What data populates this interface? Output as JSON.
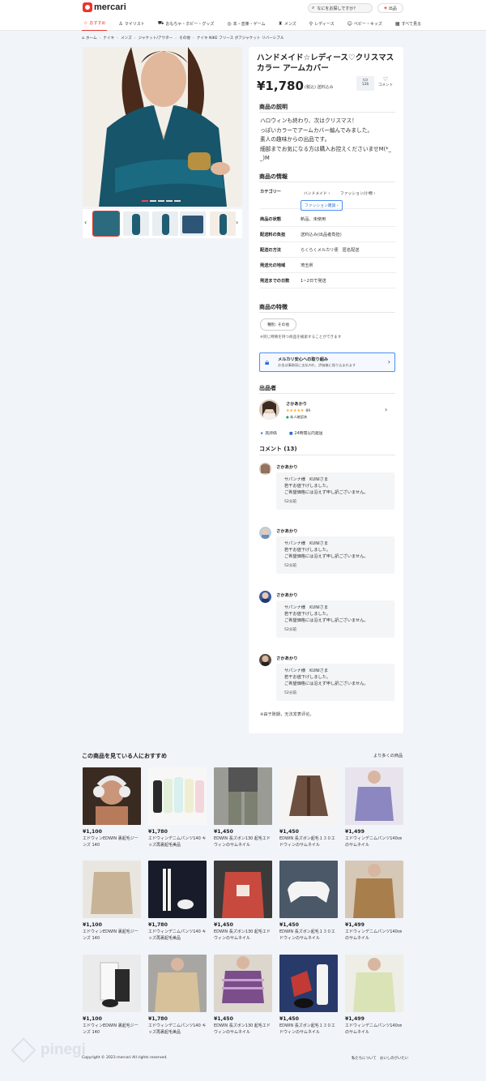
{
  "header": {
    "logo_text": "mercari",
    "search_placeholder": "なにをお探しですか？",
    "sell_label": "出品"
  },
  "nav": {
    "items": [
      {
        "label": "おすすめ",
        "icon": "star-icon",
        "active": true
      },
      {
        "label": "マイリスト",
        "icon": "user-plus-icon",
        "active": false
      },
      {
        "label": "おもちゃ・ホビー・グッズ",
        "icon": "car-toy-icon",
        "active": false
      },
      {
        "label": "本・音楽・ゲーム",
        "icon": "disc-icon",
        "active": false
      },
      {
        "label": "メンズ",
        "icon": "shirt-icon",
        "active": false
      },
      {
        "label": "レディース",
        "icon": "dress-icon",
        "active": false
      },
      {
        "label": "ベビー・キッズ",
        "icon": "baby-icon",
        "active": false
      },
      {
        "label": "すべて見る",
        "icon": "grid-icon",
        "active": false
      }
    ]
  },
  "breadcrumb": [
    "ホーム",
    "ナイキ",
    "メンズ",
    "ジャケット/アウター",
    "その他",
    "ナイキ NIKE フリース ボアジャケット リバーシブル"
  ],
  "product": {
    "title": "ハンドメイド☆レディース♡クリスマスカラー アームカバー",
    "price": "¥1,780",
    "price_note": "(税込) 送料込み",
    "share_count": "126",
    "like_label": "コメント",
    "description_heading": "商品の説明",
    "description": "ハロウィンも終わり、次はクリスマス！\nっぽいカラーでアームカバー編んでみました。\n素人の趣味からの出品です。\n細部までお気になる方は購入お控えくださいませM(*_ _)M",
    "info_heading": "商品の情報",
    "info": {
      "category_label": "カテゴリー",
      "category_tags": [
        "ハンドメイド",
        "ファッション/小物"
      ],
      "category_tag_blue": "ファッション雑貨",
      "rows": [
        {
          "k": "商品の状態",
          "v": "新品、未使用"
        },
        {
          "k": "配送料の負担",
          "v": "送料込み(出品者負担)"
        },
        {
          "k": "配送の方法",
          "v": "らくらくメルカリ便　匿名配送"
        },
        {
          "k": "発送元の地域",
          "v": "埼玉県"
        },
        {
          "k": "発送までの日数",
          "v": "1~2日で発送"
        }
      ]
    },
    "features_heading": "商品の特徴",
    "feature_tag": "種別: その他",
    "feature_note": "※同じ特徴を持つ商品を検索することができます",
    "safety_title": "メルカリ安心への取り組み",
    "safety_desc": "お金は事務局に支払われ、評価後に振り込まれます"
  },
  "seller": {
    "heading": "出品者",
    "name": "さかあかり",
    "stars": "★★★★★",
    "rating_count": "89",
    "verified": "本人確認済",
    "badges": [
      "高評価",
      "24時間以内発送"
    ]
  },
  "comments": {
    "heading": "コメント (13)",
    "items": [
      {
        "name": "さかあかり",
        "line1": "サパンナ様　KUNIさま",
        "line2": "若干お値下げしました。",
        "line3": "ご希望価格には沿えず申し訳ございません。",
        "time": "52分前"
      },
      {
        "name": "さかあかり",
        "line1": "サパンナ様　KUNIさま",
        "line2": "若干お値下げしました。",
        "line3": "ご希望価格には沿えず申し訳ございません。",
        "time": "52分前"
      },
      {
        "name": "さかあかり",
        "line1": "サパンナ様　KUNIさま",
        "line2": "若干お値下げしました。",
        "line3": "ご希望価格には沿えず申し訳ございません。",
        "time": "52分前"
      },
      {
        "name": "さかあかり",
        "line1": "サパンナ様　KUNIさま",
        "line2": "若干お値下げしました。",
        "line3": "ご希望価格には沿えず申し訳ございません。",
        "time": "52分前"
      }
    ],
    "notice": "※由于账期，无法发表评论。"
  },
  "recommend": {
    "heading": "この商品を見ている人におすすめ",
    "more": "より多くの商品",
    "rows": [
      [
        {
          "price": "¥1,100",
          "name": "エドウィンEDWIN 裏起毛ジーンズ 140"
        },
        {
          "price": "¥1,780",
          "name": "エドウィンデニムパンツ140 キッズ再裏起毛美品"
        },
        {
          "price": "¥1,450",
          "name": "EDWIN 長ズボン130 起毛エドウィンのサムネイル"
        },
        {
          "price": "¥1,450",
          "name": "EDWIN 長ズボン起毛１３０エドウィンのサムネイル"
        },
        {
          "price": "¥1,499",
          "name": "エドウィンデニムパンツ140㎝のサムネイル"
        }
      ],
      [
        {
          "price": "¥1,100",
          "name": "エドウィンEDWIN 裏起毛ジーンズ 140"
        },
        {
          "price": "¥1,780",
          "name": "エドウィンデニムパンツ140 キッズ再裏起毛美品"
        },
        {
          "price": "¥1,450",
          "name": "EDWIN 長ズボン130 起毛エドウィンのサムネイル"
        },
        {
          "price": "¥1,450",
          "name": "EDWIN 長ズボン起毛１３０エドウィンのサムネイル"
        },
        {
          "price": "¥1,499",
          "name": "エドウィンデニムパンツ140㎝のサムネイル"
        }
      ],
      [
        {
          "price": "¥1,100",
          "name": "エドウィンEDWIN 裏起毛ジーンズ 140"
        },
        {
          "price": "¥1,780",
          "name": "エドウィンデニムパンツ140 キッズ再裏起毛美品"
        },
        {
          "price": "¥1,450",
          "name": "EDWIN 長ズボン130 起毛エドウィンのサムネイル"
        },
        {
          "price": "¥1,450",
          "name": "EDWIN 長ズボン起毛１３０エドウィンのサムネイル"
        },
        {
          "price": "¥1,499",
          "name": "エドウィンデニムパンツ140㎝のサムネイル"
        }
      ]
    ]
  },
  "footer": {
    "copyright": "Copyright © 2023 mercari All rights reserved.",
    "links": "私たちについて　おいしのがいたい",
    "watermark": "pinegi"
  },
  "colors": {
    "accent": "#ea352d",
    "link_blue": "#2a6bd1",
    "rating": "#f5a623",
    "background": "#f1f4f9"
  }
}
